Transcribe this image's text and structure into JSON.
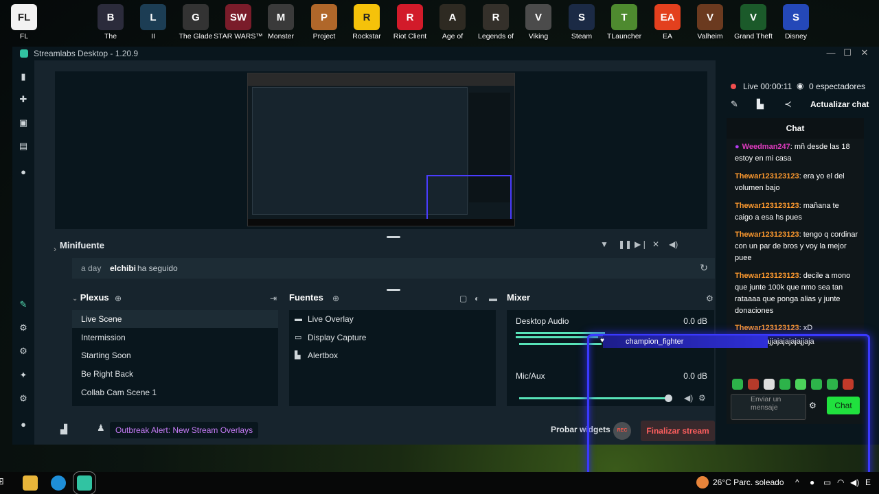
{
  "desktop": {
    "icons": [
      {
        "label": "FL",
        "color": "#f2f2f2",
        "glyph": "FL"
      },
      {
        "label": "The",
        "color": "#2b2b3b",
        "glyph": "B"
      },
      {
        "label": "II",
        "color": "#1c3d54",
        "glyph": "L"
      },
      {
        "label": "The Glade",
        "color": "#333",
        "glyph": "G"
      },
      {
        "label": "STAR WARS™",
        "color": "#7a1c2a",
        "glyph": "SW"
      },
      {
        "label": "Monster",
        "color": "#3a3a3a",
        "glyph": "M"
      },
      {
        "label": "Project",
        "color": "#b0672a",
        "glyph": "P"
      },
      {
        "label": "Rockstar",
        "color": "#f5c20a",
        "glyph": "R"
      },
      {
        "label": "Riot Client",
        "color": "#d21b2a",
        "glyph": "R"
      },
      {
        "label": "Age of",
        "color": "#2e2a22",
        "glyph": "A"
      },
      {
        "label": "Legends of",
        "color": "#34302a",
        "glyph": "R"
      },
      {
        "label": "Viking",
        "color": "#4b4b4b",
        "glyph": "V"
      },
      {
        "label": "Steam",
        "color": "#1b2a45",
        "glyph": "S"
      },
      {
        "label": "TLauncher",
        "color": "#4e8a2f",
        "glyph": "T"
      },
      {
        "label": "EA",
        "color": "#e3401e",
        "glyph": "EA"
      },
      {
        "label": "Valheim",
        "color": "#6b3a1f",
        "glyph": "V"
      },
      {
        "label": "Grand Theft",
        "color": "#1b5a2a",
        "glyph": "V"
      },
      {
        "label": "Disney",
        "color": "#2448b8",
        "glyph": "S"
      }
    ]
  },
  "window": {
    "title": "Streamlabs Desktop - 1.20.9",
    "minimize": "—",
    "maximize": "☐",
    "close": "✕"
  },
  "minifuente": {
    "title": "Minifuente",
    "event": {
      "time": "a day",
      "user": "elchibi",
      "text": "ha seguido"
    }
  },
  "scenes": {
    "title": "Plexus",
    "items": [
      "Live Scene",
      "Intermission",
      "Starting Soon",
      "Be Right Back",
      "Collab Cam Scene 1"
    ]
  },
  "sources": {
    "title": "Fuentes",
    "items": [
      "Live Overlay",
      "Display Capture",
      "Alertbox"
    ]
  },
  "mixer": {
    "title": "Mixer",
    "channels": [
      {
        "name": "Desktop Audio",
        "db": "0.0 dB"
      },
      {
        "name": "Mic/Aux",
        "db": "0.0 dB"
      }
    ]
  },
  "footer": {
    "news": "Outbreak Alert: New Stream Overlays",
    "test_widgets": "Probar widgets",
    "rec": "REC",
    "end_stream": "Finalizar stream"
  },
  "sidebar": {
    "live": "Live 00:00:11",
    "viewers": "0 espectadores",
    "refresh_chat": "Actualizar chat",
    "chat_title": "Chat",
    "messages": [
      {
        "user": "Weedman247",
        "text": "mñ desde las 18 estoy en mi casa",
        "mic": true
      },
      {
        "user": "Thewar123123123",
        "text": "era yo el del volumen bajo",
        "mic": false
      },
      {
        "user": "Thewar123123123",
        "text": "mañana te caigo a esa hs pues",
        "mic": false
      },
      {
        "user": "Thewar123123123",
        "text": "tengo q cordinar con un par de bros y voy la mejor puee",
        "mic": false
      },
      {
        "user": "Thewar123123123",
        "text": "decile a mono que junte 100k que nmo sea tan rataaaa que ponga alias y junte donaciones",
        "mic": false
      },
      {
        "user": "Thewar123123123",
        "text": "xD",
        "mic": false
      },
      {
        "user": "Wee",
        "text": "kajjajajajajajjaja",
        "mic": true
      }
    ],
    "input_placeholder": "Enviar un mensaje",
    "chat_button": "Chat"
  },
  "overlay": {
    "name": "champion_fighter"
  },
  "taskbar": {
    "weather": "26°C  Parc. soleado"
  },
  "colors": {
    "accent": "#31c3a2",
    "live_red": "#f24e4e",
    "chat_green": "#20e13e",
    "news_purple": "#c57bf5",
    "overlay_blue": "#3a39ff"
  }
}
